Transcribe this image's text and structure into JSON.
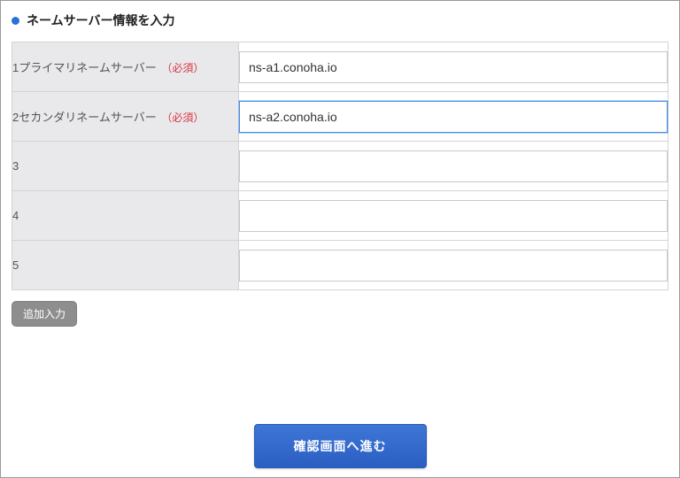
{
  "section_title": "ネームサーバー情報を入力",
  "required_label": "（必須）",
  "rows": [
    {
      "label": "1プライマリネームサーバー",
      "required": true,
      "value": "ns-a1.conoha.io"
    },
    {
      "label": "2セカンダリネームサーバー",
      "required": true,
      "value": "ns-a2.conoha.io"
    },
    {
      "label": "3",
      "required": false,
      "value": ""
    },
    {
      "label": "4",
      "required": false,
      "value": ""
    },
    {
      "label": "5",
      "required": false,
      "value": ""
    }
  ],
  "add_button_label": "追加入力",
  "submit_button_label": "確認画面へ進む"
}
